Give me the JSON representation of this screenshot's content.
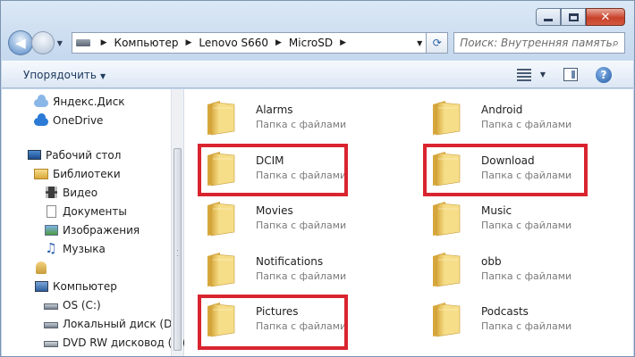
{
  "caption": {
    "minimize_icon": "minimize-icon",
    "maximize_icon": "maximize-icon",
    "close_glyph": "✕"
  },
  "nav": {
    "back_glyph": "◀",
    "breadcrumb": [
      "Компьютер",
      "Lenovo S660",
      "MicroSD"
    ],
    "separator": "▶",
    "dropdown": "▼",
    "refresh_glyph": "⟳",
    "search_placeholder": "Поиск: Внутренняя память",
    "search_glyph": "⌕"
  },
  "toolbar": {
    "organize_label": "Упорядочить",
    "organize_arrow": "▼",
    "help_glyph": "?"
  },
  "sidebar": {
    "favorites": [
      {
        "label": "Яндекс.Диск",
        "icon": "yandex-disk-icon"
      },
      {
        "label": "OneDrive",
        "icon": "onedrive-icon"
      }
    ],
    "desktop": {
      "label": "Рабочий стол",
      "icon": "desktop-icon"
    },
    "libraries": {
      "label": "Библиотеки",
      "icon": "libraries-icon"
    },
    "library_items": [
      {
        "label": "Видео",
        "icon": "video-icon"
      },
      {
        "label": "Документы",
        "icon": "documents-icon"
      },
      {
        "label": "Изображения",
        "icon": "pictures-icon"
      },
      {
        "label": "Музыка",
        "icon": "music-icon"
      }
    ],
    "user_icon": "user-folder-icon",
    "computer": {
      "label": "Компьютер",
      "icon": "computer-icon"
    },
    "drives": [
      {
        "label": "OS (C:)",
        "icon": "hdd-icon"
      },
      {
        "label": "Локальный диск (D:)",
        "icon": "hdd-icon"
      },
      {
        "label": "DVD RW дисковод (F:)",
        "icon": "dvd-icon"
      }
    ]
  },
  "folder_type_label": "Папка с файлами",
  "folders": [
    {
      "name": "Alarms",
      "highlighted": false
    },
    {
      "name": "Android",
      "highlighted": false
    },
    {
      "name": "DCIM",
      "highlighted": true
    },
    {
      "name": "Download",
      "highlighted": true
    },
    {
      "name": "Movies",
      "highlighted": false
    },
    {
      "name": "Music",
      "highlighted": false
    },
    {
      "name": "Notifications",
      "highlighted": false
    },
    {
      "name": "obb",
      "highlighted": false
    },
    {
      "name": "Pictures",
      "highlighted": true
    },
    {
      "name": "Podcasts",
      "highlighted": false
    }
  ],
  "colors": {
    "highlight": "#d9242f",
    "folder_light": "#f6dd88",
    "folder_dark": "#d7a73c"
  }
}
